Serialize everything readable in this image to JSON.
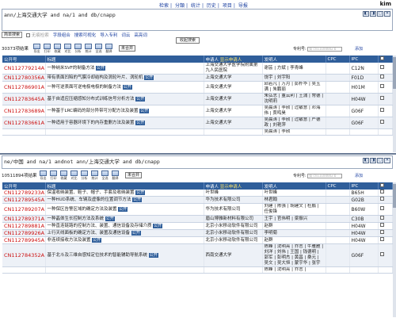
{
  "topnav": {
    "links": [
      "检索",
      "分類",
      "统计",
      "历史",
      "项目",
      "导报"
    ],
    "separator": "|",
    "user": "kim"
  },
  "pane1": {
    "query": "ann/上海交通大学 and na/1 and db/cnapp",
    "query_icons": [
      "◧",
      "◨",
      "▢",
      "✕"
    ],
    "search_type_select": "简单搜索",
    "chk_label": "无痕检索",
    "links": [
      "字段组合",
      "搜索可视化",
      "导入专利",
      "词云",
      "高亮词"
    ],
    "popup_label": "收起搜索",
    "count": "30373项结果",
    "toolbar": [
      {
        "label": "导出",
        "icon": "export-icon"
      },
      {
        "label": "打印",
        "icon": "print-icon"
      },
      {
        "label": "收藏",
        "icon": "favorite-icon"
      },
      {
        "label": "对比",
        "icon": "compare-icon"
      },
      {
        "label": "分析",
        "icon": "analyze-icon"
      },
      {
        "label": "统计",
        "icon": "stats-icon"
      },
      {
        "label": "全选",
        "icon": "select-all-icon"
      },
      {
        "label": "翻译",
        "icon": "translate-icon"
      }
    ],
    "unmerge_label": "未合并",
    "patent_no_label": "专利号:",
    "patent_no_placeholder": "如 cn11100002 b",
    "add_label": "添加",
    "columns": {
      "pn": "公开号",
      "title": "标题",
      "applicant": "申请人",
      "applicant_sub": "显示申请人",
      "inventor": "发明人",
      "cpc": "CPC",
      "ipc": "IPC"
    },
    "rows": [
      {
        "pn": "CN112779214A",
        "title": "一种纳米SVF的制备方法",
        "badge": "公开",
        "applicant": "上海交通大学医学院附属第九人民医院",
        "inventor": "谢芸 | 方斌 | 李青峰",
        "cpc": "",
        "ipc": "C12N"
      },
      {
        "pn": "CN112780356A",
        "title": "带有表面凹陷的气膜冷却结构及涡轮叶片、涡轮机",
        "badge": "公开",
        "applicant": "上海交通大学",
        "inventor": "饶宇 | 刘宇阳",
        "cpc": "",
        "ipc": "F01D"
      },
      {
        "pn": "CN112786901A",
        "title": "一种可逆表面可逆电极电极的制备方法",
        "badge": "公开",
        "applicant": "上海交通大学",
        "inventor": "邱若凡 | 万月 | 彭朴华 | 吴玉满 | 朱鹏丽",
        "cpc": "",
        "ipc": "H01M"
      },
      {
        "pn": "CN112783645A",
        "title": "基于自适应压缩感知分布式训练信号分析方法",
        "badge": "公开",
        "applicant": "上海交通大学",
        "inventor": "朱弘志 | 董云利 | 王蒲 | 常德 | 沈明莉",
        "cpc": "",
        "ipc": "H04W"
      },
      {
        "pn": "CN112783689A",
        "title": "一种基于LRC编码的部分异带可分配方法及装置",
        "badge": "公开",
        "applicant": "上海交通大学",
        "inventor": "吴晨涛 | 李颀 | 过敏意 | 邓海伟 | 贾鸣昊",
        "cpc": "",
        "ipc": "G06F"
      },
      {
        "pn": "CN112783661A",
        "title": "一种适用于容器环境下的内存重删方法及装置",
        "badge": "公开",
        "applicant": "上海交通大学",
        "inventor": "吴晨涛 | 李颀 | 过敏意 | 严德政 | 刘艳萍",
        "cpc": "",
        "ipc": "G06F"
      },
      {
        "pn": "",
        "title": "",
        "badge": "",
        "applicant": "",
        "inventor": "吴晨涛 | 李颀",
        "cpc": "",
        "ipc": ""
      }
    ]
  },
  "pane2": {
    "query": "ne/中国 and na/1 andnot ann/上海交通大学 and db/cnapp",
    "query_icons": [
      "◧",
      "◨",
      "▢",
      "✕"
    ],
    "count": "10511894项结果",
    "toolbar": [
      {
        "label": "导出",
        "icon": "export-icon"
      },
      {
        "label": "打印",
        "icon": "print-icon"
      },
      {
        "label": "收藏",
        "icon": "favorite-icon"
      },
      {
        "label": "对比",
        "icon": "compare-icon"
      },
      {
        "label": "分析",
        "icon": "analyze-icon"
      },
      {
        "label": "统计",
        "icon": "stats-icon"
      },
      {
        "label": "全选",
        "icon": "select-all-icon"
      },
      {
        "label": "翻译",
        "icon": "translate-icon"
      }
    ],
    "unmerge_label": "未合并",
    "patent_no_label": "专利号:",
    "patent_no_placeholder": "如 cn11100002 b",
    "add_label": "添加",
    "columns": {
      "pn": "公开号",
      "title": "标题",
      "applicant": "申请人",
      "applicant_sub": "显示申请人",
      "inventor": "发明人",
      "cpc": "CPC",
      "ipc": "IPC"
    },
    "rows": [
      {
        "pn": "CN112789233A",
        "title": "保温收纳装置、鞋子、帽子、手套及收纳装置",
        "badge": "公开",
        "applicant": "叶世峰",
        "inventor": "叶世峰",
        "cpc": "",
        "ipc": "B65H"
      },
      {
        "pn": "CN112789545A",
        "title": "一种HUD系统、车辆及虚像的位置调节方法",
        "badge": "公开",
        "applicant": "华为技术有限公司",
        "inventor": "林君翰",
        "cpc": "",
        "ipc": "G02B"
      },
      {
        "pn": "CN112789207A",
        "title": "一种保区告警区域的确定方法及装置",
        "badge": "公开",
        "applicant": "华为技术有限公司",
        "inventor": "刘建 | 陈强 | 胡建文 | 杜鹏 | 任俊锋",
        "cpc": "",
        "ipc": "B60W"
      },
      {
        "pn": "CN112789371A",
        "title": "一种晶体生长控制方法及系统",
        "badge": "公开",
        "applicant": "眉山博雅新材料有限公司",
        "inventor": "王宇 | 官伟明 | 梁振兴",
        "cpc": "",
        "ipc": "C30B"
      },
      {
        "pn": "CN112789881A",
        "title": "一种直连链路的控制方法、装置、通信设备及存储介质",
        "badge": "公开",
        "applicant": "北京小米移动软件有限公司",
        "inventor": "赵群",
        "cpc": "",
        "ipc": "H04W"
      },
      {
        "pn": "CN112789926A",
        "title": "上行天线面板的确定方法、装置及通信设备",
        "badge": "公开",
        "applicant": "北京小米移动软件有限公司",
        "inventor": "李明菊",
        "cpc": "",
        "ipc": "H04W"
      },
      {
        "pn": "CN112789945A",
        "title": "非连续接收方法及装置",
        "badge": "公开",
        "applicant": "北京小米移动软件有限公司",
        "inventor": "赵群",
        "cpc": "",
        "ipc": "H04W"
      },
      {
        "pn": "CN112784352A",
        "title": "基于北斗及三维自感知定位技术的智能辅助导航系统",
        "badge": "公开",
        "applicant": "西南交通大学",
        "inventor": "陈峰 | 沈明亮 | 乔志 | 牛雁雁 | 刘洋 | 刘伟 | 王国 | 钱德明 | 郭军 | 彭明杰 | 黄昌 | 桑元 | 吴文 | 吴大恒 | 蒙宇华 | 张宇",
        "cpc": "",
        "ipc": "G06F"
      },
      {
        "pn": "",
        "title": "",
        "badge": "",
        "applicant": "",
        "inventor": "陈峰 | 沈明亮 | 乔志 |",
        "cpc": "",
        "ipc": ""
      }
    ]
  }
}
